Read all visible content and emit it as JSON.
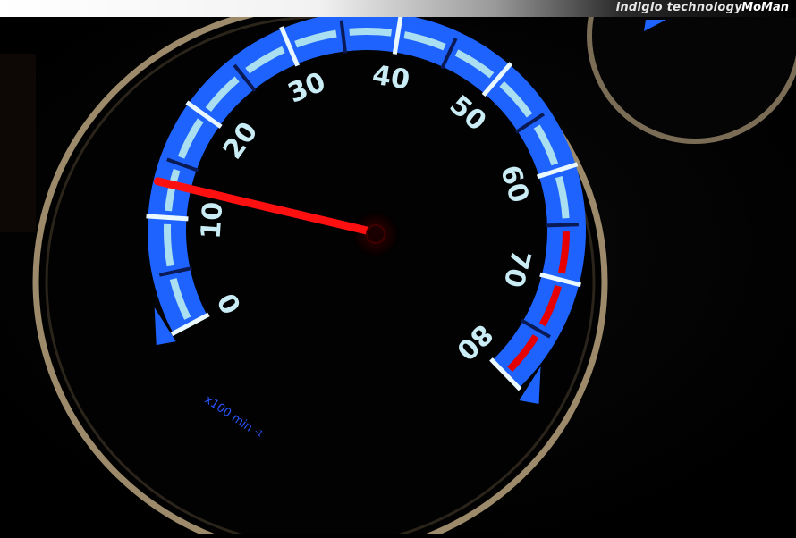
{
  "banner": {
    "tagline": "indiglo technology",
    "brand": "MoMan"
  },
  "gauge": {
    "dial_labels": [
      "0",
      "10",
      "20",
      "30",
      "40",
      "50",
      "60",
      "70",
      "80"
    ],
    "unit": "x100 min",
    "unit_exponent": "-1",
    "needle_value": 13,
    "max_value": 80,
    "redline_from": 63
  },
  "colors": {
    "dial_blue": "#1f63ff",
    "redline": "#e60000",
    "needle": "#ff1010",
    "numeral": "#c9ecf5",
    "bezel": "#9c8a6a"
  }
}
